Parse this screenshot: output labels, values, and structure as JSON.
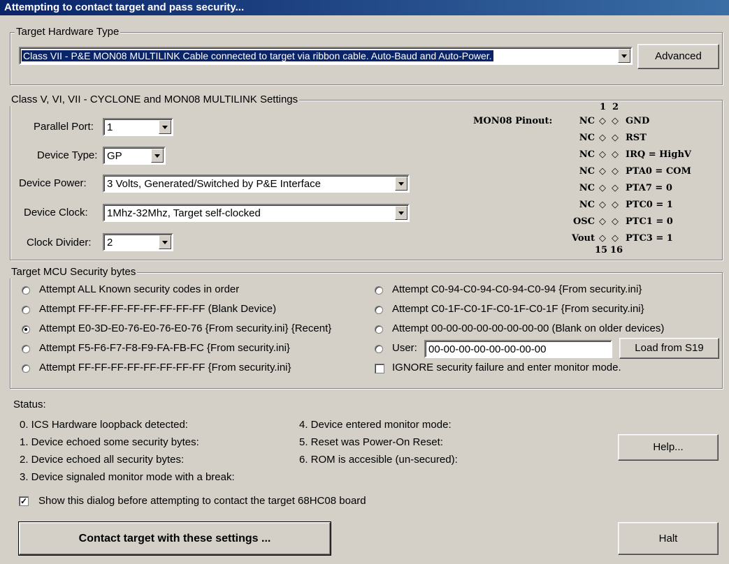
{
  "window": {
    "title": "Attempting to contact target and pass security..."
  },
  "hardware": {
    "legend": "Target Hardware Type",
    "selected": "Class VII - P&E MON08 MULTILINK Cable connected to target via ribbon cable. Auto-Baud and Auto-Power.",
    "advanced_label": "Advanced"
  },
  "settings": {
    "legend": "Class V, VI, VII - CYCLONE and MON08 MULTILINK Settings",
    "parallel_port": {
      "label": "Parallel Port:",
      "value": "1"
    },
    "device_type": {
      "label": "Device Type:",
      "value": "GP"
    },
    "device_power": {
      "label": "Device Power:",
      "value": "3 Volts, Generated/Switched by P&E Interface"
    },
    "device_clock": {
      "label": "Device Clock:",
      "value": "1Mhz-32Mhz, Target self-clocked"
    },
    "clock_divider": {
      "label": "Clock Divider:",
      "value": "2"
    }
  },
  "pinout": {
    "title": "MON08 Pinout:",
    "col_top_1": "1",
    "col_top_2": "2",
    "col_bottom_1": "15",
    "col_bottom_2": "16",
    "rows": [
      {
        "left": "NC",
        "right": "GND"
      },
      {
        "left": "NC",
        "right": "RST"
      },
      {
        "left": "NC",
        "right": "IRQ = HighV"
      },
      {
        "left": "NC",
        "right": "PTA0 = COM"
      },
      {
        "left": "NC",
        "right": "PTA7 = 0"
      },
      {
        "left": "NC",
        "right": "PTC0 = 1"
      },
      {
        "left": "OSC",
        "right": "PTC1 = 0"
      },
      {
        "left": "Vout",
        "right": "PTC3 = 1"
      }
    ],
    "pin_glyph": "◇"
  },
  "security": {
    "legend": "Target MCU Security bytes",
    "left_options": [
      "Attempt ALL Known security codes in order",
      "Attempt FF-FF-FF-FF-FF-FF-FF-FF (Blank Device)",
      "Attempt E0-3D-E0-76-E0-76-E0-76 {From security.ini} {Recent}",
      "Attempt F5-F6-F7-F8-F9-FA-FB-FC {From security.ini}",
      "Attempt FF-FF-FF-FF-FF-FF-FF-FF {From security.ini}"
    ],
    "right_options": [
      "Attempt C0-94-C0-94-C0-94-C0-94 {From security.ini}",
      "Attempt C0-1F-C0-1F-C0-1F-C0-1F {From security.ini}",
      "Attempt 00-00-00-00-00-00-00-00 (Blank on older devices)"
    ],
    "user_label": "User:",
    "user_value": "00-00-00-00-00-00-00-00",
    "load_label": "Load from S19",
    "ignore_label": "IGNORE security failure and enter monitor mode."
  },
  "status": {
    "label": "Status:",
    "left_items": [
      "0. ICS Hardware loopback detected:",
      "1. Device echoed some security bytes:",
      "2. Device echoed all security bytes:",
      "3. Device signaled monitor mode with a break:"
    ],
    "right_items": [
      "4. Device entered monitor mode:",
      "5. Reset was Power-On Reset:",
      "6. ROM is accesible (un-secured):"
    ]
  },
  "help_label": "Help...",
  "show_dialog_label": "Show this dialog before attempting to contact the target 68HC08 board",
  "contact_label": "Contact target with these settings ...",
  "halt_label": "Halt"
}
